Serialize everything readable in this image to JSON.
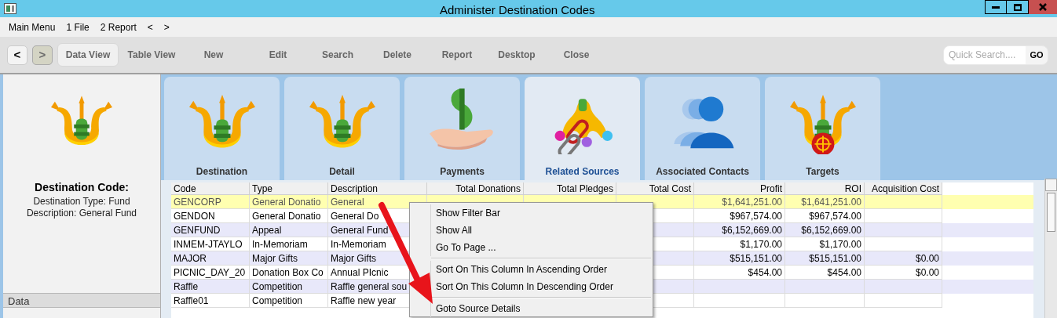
{
  "window": {
    "title": "Administer Destination Codes"
  },
  "menu_bar": [
    "Main Menu",
    "1 File",
    "2 Report",
    "<",
    ">"
  ],
  "toolbar": {
    "back": {
      "label": "<",
      "disabled": false
    },
    "forward": {
      "label": ">",
      "disabled": true
    },
    "buttons": [
      {
        "label": "Data View",
        "selected": true
      },
      {
        "label": "Table View",
        "selected": false
      },
      {
        "label": "New",
        "selected": false
      },
      {
        "label": "Edit",
        "selected": false
      },
      {
        "label": "Search",
        "selected": false
      },
      {
        "label": "Delete",
        "selected": false
      },
      {
        "label": "Report",
        "selected": false
      },
      {
        "label": "Desktop",
        "selected": false
      },
      {
        "label": "Close",
        "selected": false
      }
    ],
    "quick_search": {
      "placeholder": "Quick Search....",
      "button": "GO"
    }
  },
  "summary": {
    "kind": "fork-dollar",
    "title": "Destination Code:",
    "lines": [
      "Destination Type: Fund",
      "Description: General Fund"
    ]
  },
  "side_sections": [
    {
      "label": "Data"
    }
  ],
  "tabs": [
    {
      "label": "Destination",
      "kind": "fork-dollar",
      "selected": false
    },
    {
      "label": "Detail",
      "kind": "fork-dollar",
      "selected": false
    },
    {
      "label": "Payments",
      "kind": "hand-dollar",
      "selected": false
    },
    {
      "label": "Related Sources",
      "kind": "link-chain",
      "selected": true
    },
    {
      "label": "Associated Contacts",
      "kind": "people",
      "selected": false
    },
    {
      "label": "Targets",
      "kind": "fork-target",
      "selected": false
    }
  ],
  "table": {
    "columns": [
      "Code",
      "Type",
      "Description",
      "Total Donations",
      "Total Pledges",
      "Total Cost",
      "Profit",
      "ROI",
      "Acquisition Cost"
    ],
    "rows": [
      {
        "selected": true,
        "cells": [
          "GENCORP",
          "General Donatio",
          "General",
          null,
          null,
          null,
          "$1,641,251.00",
          "$1,641,251.00",
          null
        ]
      },
      {
        "selected": false,
        "cells": [
          "GENDON",
          "General Donatio",
          "General Do",
          null,
          null,
          null,
          "$967,574.00",
          "$967,574.00",
          null
        ]
      },
      {
        "selected": false,
        "cells": [
          "GENFUND",
          "Appeal",
          "General Fund",
          null,
          null,
          null,
          "$6,152,669.00",
          "$6,152,669.00",
          null
        ]
      },
      {
        "selected": false,
        "cells": [
          "INMEM-JTAYLO",
          "In-Memoriam",
          "In-Memoriam",
          null,
          null,
          null,
          "$1,170.00",
          "$1,170.00",
          null
        ]
      },
      {
        "selected": false,
        "cells": [
          "MAJOR",
          "Major Gifts",
          "Major Gifts",
          null,
          null,
          null,
          "$515,151.00",
          "$515,151.00",
          "$0.00"
        ]
      },
      {
        "selected": false,
        "cells": [
          "PICNIC_DAY_20",
          "Donation Box Co",
          "Annual PIcnic",
          null,
          null,
          null,
          "$454.00",
          "$454.00",
          "$0.00"
        ]
      },
      {
        "selected": false,
        "cells": [
          "Raffle",
          "Competition",
          "Raffle general sou",
          null,
          null,
          null,
          null,
          null,
          null
        ]
      },
      {
        "selected": false,
        "cells": [
          "Raffle01",
          "Competition",
          "Raffle new year",
          null,
          null,
          null,
          null,
          null,
          null
        ]
      }
    ]
  },
  "context_menu": {
    "groups": [
      [
        "Show Filter Bar",
        "Show All",
        "Go To Page ..."
      ],
      [
        "Sort On This Column In Ascending Order",
        "Sort On This Column In Descending Order"
      ],
      [
        "Goto Source Details"
      ]
    ]
  }
}
